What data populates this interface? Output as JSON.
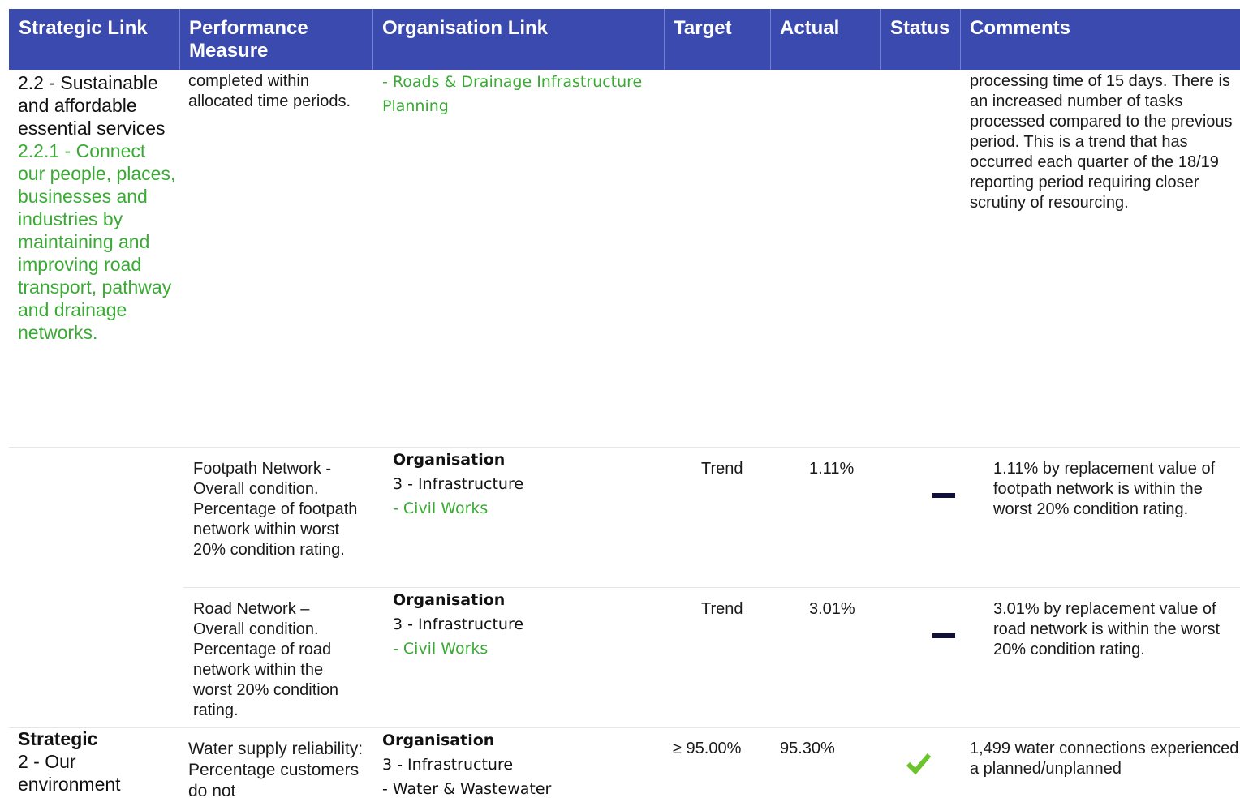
{
  "table": {
    "headers": {
      "strategic_link": "Strategic Link",
      "performance_measure": "Performance Measure",
      "organisation_link": "Organisation Link",
      "target": "Target",
      "actual": "Actual",
      "status": "Status",
      "comments": "Comments"
    },
    "row1": {
      "strategic_heading": "2.2 - Sustainable and affordable essential services",
      "strategic_sub": "2.2.1 - Connect our people, places, businesses and industries by maintaining and improving road transport, pathway and drainage networks.",
      "measure": "completed within allocated time periods.",
      "org_sub": "- Roads & Drainage Infrastructure Planning",
      "comment": "processing time of 15 days.  There is an increased number of tasks processed compared to the previous period. This is a trend that has occurred each quarter of the 18/19 reporting period requiring closer scrutiny of resourcing."
    },
    "row2": {
      "measure": "Footpath Network - Overall condition. Percentage of footpath network within worst 20% condition rating.",
      "org_title": "Organisation",
      "org_dept": "3 - Infrastructure",
      "org_sub": "- Civil Works",
      "target": "Trend",
      "actual": "1.11%",
      "status_icon": "dash-icon",
      "comment": "1.11% by replacement value of footpath network is within the worst 20% condition rating."
    },
    "row3": {
      "measure": "Road Network – Overall condition. Percentage of road network within the worst 20% condition rating.",
      "org_title": "Organisation",
      "org_dept": "3 - Infrastructure",
      "org_sub": "- Civil Works",
      "target": "Trend",
      "actual": "3.01%",
      "status_icon": "dash-icon",
      "comment": "3.01% by replacement value of road network is within the worst 20% condition rating."
    },
    "row4": {
      "strategic_title": "Strategic",
      "strategic_sub": "2 - Our environment",
      "measure": "Water supply reliability: Percentage customers do not",
      "org_title": "Organisation",
      "org_dept": "3 - Infrastructure",
      "org_sub": "- Water & Wastewater",
      "target": "≥ 95.00%",
      "actual": "95.30%",
      "status_icon": "check-icon",
      "comment": "1,499 water connections experienced a planned/unplanned"
    }
  },
  "colors": {
    "header_bg": "#3b4aae",
    "green_text": "#3aaa35",
    "check": "#6cc42c",
    "dash": "#10103a"
  }
}
